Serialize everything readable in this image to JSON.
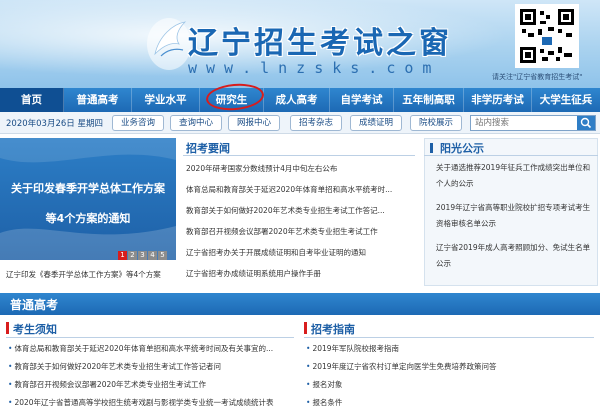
{
  "header": {
    "title": "辽宁招生考试之窗",
    "url": "www.lnzsks.com",
    "qr_note": "请关注\"辽宁省教育招生考试\""
  },
  "nav": {
    "items": [
      "首页",
      "普通高考",
      "学业水平",
      "研究生",
      "成人高考",
      "自学考试",
      "五年制高职",
      "非学历考试",
      "大学生征兵"
    ],
    "highlighted": "研究生"
  },
  "toolbar": {
    "date": "2020年03月26日 星期四",
    "buttons": [
      "业务咨询",
      "查询中心",
      "网报中心",
      "招考杂志",
      "成绩证明",
      "院校展示"
    ],
    "search_placeholder": "站内搜索"
  },
  "banner": {
    "line1": "关于印发春季开学总体工作方案",
    "line2": "等4个方案的通知",
    "caption": "辽宁印发《春季开学总体工作方案》等4个方案",
    "pages": [
      "1",
      "2",
      "3",
      "4",
      "5"
    ],
    "active_page": "1"
  },
  "news": {
    "title": "招考要闻",
    "items": [
      "2020年研考国家分数线预计4月中旬左右公布",
      "体育总局和教育部关于延迟2020年体育单招和高水平统考时...",
      "教育部关于如何做好2020年艺术类专业招生考试工作答记...",
      "教育部召开视频会议部署2020年艺术类专业招生考试工作",
      "辽宁省招考办关于开展成绩证明和自考毕业证明的通知",
      "辽宁省招考办成绩证明系统用户操作手册"
    ]
  },
  "publicity": {
    "title": "阳光公示",
    "items": [
      "关于通选推荐2019年征兵工作成绩突出单位和个人的公示",
      "2019年辽宁省高等职业院校扩招专项考试考生资格审核名单公示",
      "辽宁省2019年成人高考照顾加分、免试生名单公示"
    ]
  },
  "section": {
    "title": "普通高考",
    "left_title": "考生须知",
    "left_items": [
      "体育总局和教育部关于延迟2020年体育单招和高水平统考时间及有关事宜的...",
      "教育部关于如何做好2020年艺术类专业招生考试工作答记者问",
      "教育部召开视频会议部署2020年艺术类专业招生考试工作",
      "2020年辽宁省普通高等学校招生统考戏剧与影视学类专业统一考试成绩统计表"
    ],
    "right_title": "招考指南",
    "right_items": [
      "2019年军队院校报考指南",
      "2019年度辽宁省农村订单定向医学生免费培养政策问答",
      "报名对象",
      "报名条件"
    ]
  },
  "colors": {
    "nav_blue": "#1d69b4",
    "title_blue": "#1d5fa6",
    "accent_red": "#d81d1d"
  }
}
